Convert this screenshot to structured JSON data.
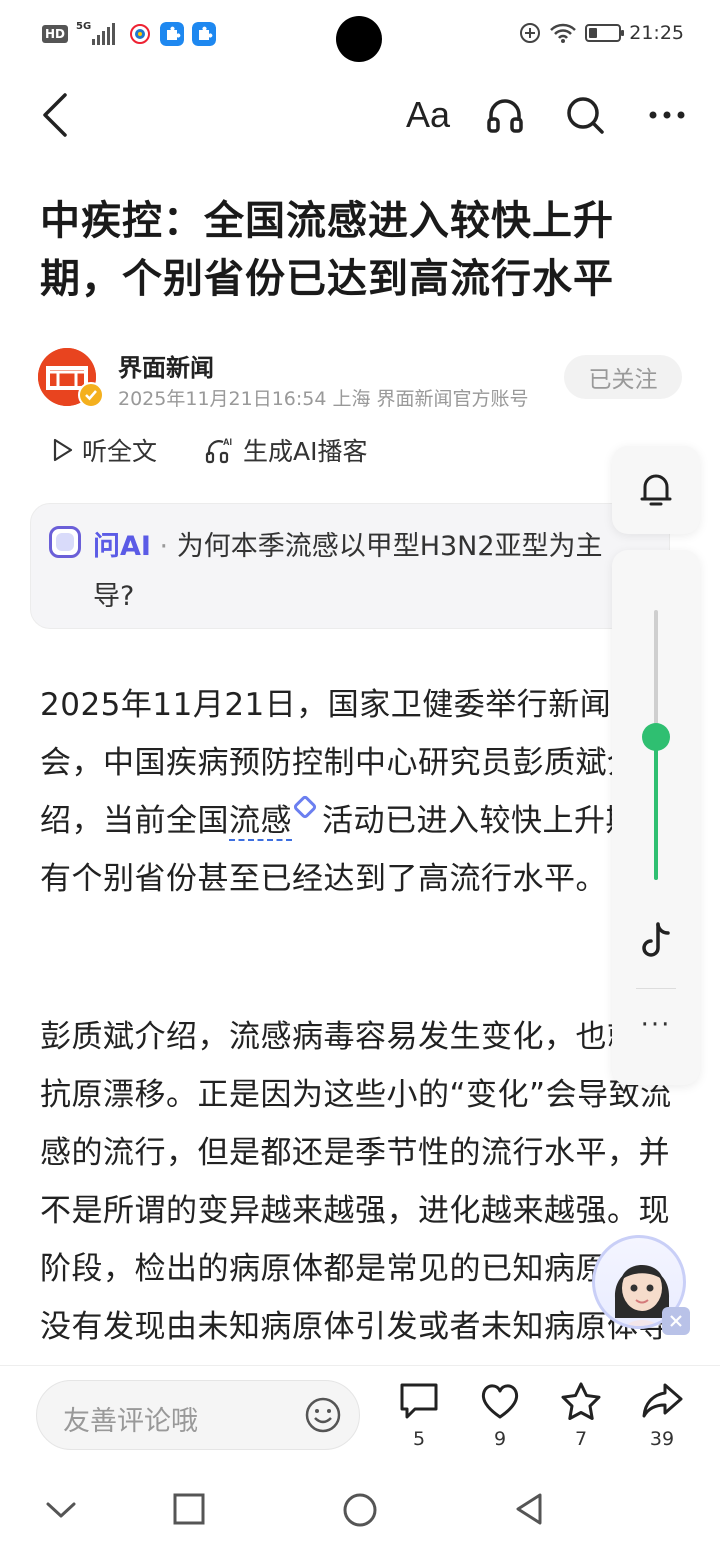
{
  "status_bar": {
    "hd": "HD",
    "network": "5G",
    "time": "21:25"
  },
  "toolbar": {
    "font_label": "Aa"
  },
  "article": {
    "title": "中疾控：全国流感进入较快上升期，个别省份已达到高流行水平",
    "author_name": "界面新闻",
    "meta": "2025年11月21日16:54 上海 界面新闻官方账号",
    "follow_label": "已关注",
    "listen_label": "听全文",
    "podcast_label": "生成AI播客",
    "ai_label": "问AI",
    "ai_separator": " · ",
    "ai_question": "为何本季流感以甲型H3N2亚型为主导?",
    "p1_before": "2025年11月21日，国家卫健委举行新闻发布会，中国疾病预防控制中心研究员彭质斌介绍，当前全国",
    "p1_link": "流感",
    "p1_after": "活动已进入较快上升期，有个别省份甚至已经达到了高流行水平。",
    "p2": "彭质斌介绍，流感病毒容易发生变化，也就是抗原漂移。正是因为这些小的“变化”会导致流感的流行，但是都还是季节性的流行水平，并不是所谓的变异越来越强，进化越来越强。现阶段，检出的病原体都是常见的已知病原体，没有发现由未知病原体引发或者未知病原体导致的异常传染性疾病。"
  },
  "side_panel": {
    "volume_level": 0.53,
    "more_label": "···"
  },
  "bottom_bar": {
    "comment_placeholder": "友善评论哦",
    "comments_count": "5",
    "likes_count": "9",
    "favorites_count": "7",
    "shares_count": "39"
  },
  "colors": {
    "accent_green": "#2fbf71",
    "ai_purple": "#5b5be6",
    "brand_red": "#e8441f"
  }
}
